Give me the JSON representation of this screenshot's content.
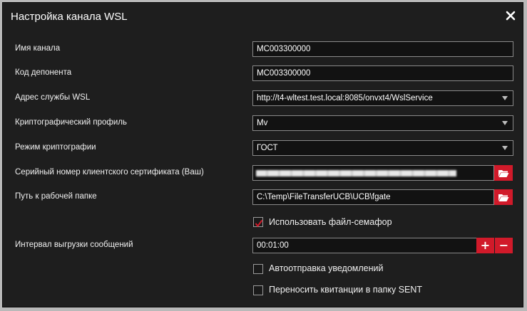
{
  "dialog": {
    "title": "Настройка канала WSL",
    "close_icon": "close-icon"
  },
  "fields": {
    "channel_name": {
      "label": "Имя канала",
      "value": "MC003300000"
    },
    "depositor_code": {
      "label": "Код депонента",
      "value": "MC003300000"
    },
    "wsl_address": {
      "label": "Адрес службы WSL",
      "value": "http://t4-wltest.test.local:8085/onvxt4/WslService"
    },
    "crypto_profile": {
      "label": "Криптографический профиль",
      "value": "Mv"
    },
    "crypto_mode": {
      "label": "Режим криптографии",
      "value": "ГОСТ"
    },
    "client_cert_serial": {
      "label": "Серийный номер клиентского сертификата (Ваш)",
      "value": ""
    },
    "work_folder": {
      "label": "Путь к рабочей папке",
      "value": "C:\\Temp\\FileTransferUCB\\UCB\\fgate"
    },
    "upload_interval": {
      "label": "Интервал выгрузки сообщений",
      "value": "00:01:00",
      "plus": "+",
      "minus": "−"
    }
  },
  "checkboxes": {
    "use_semaphore": {
      "label": "Использовать файл-семафор",
      "checked": true
    },
    "auto_send_notifications": {
      "label": "Автоотправка уведомлений",
      "checked": false
    },
    "move_receipts_sent": {
      "label": "Переносить квитанции в папку SENT",
      "checked": false
    }
  },
  "colors": {
    "background": "#1e1e1e",
    "accent": "#d11a2a",
    "field_border": "#8a8a8a",
    "text": "#ffffff"
  }
}
